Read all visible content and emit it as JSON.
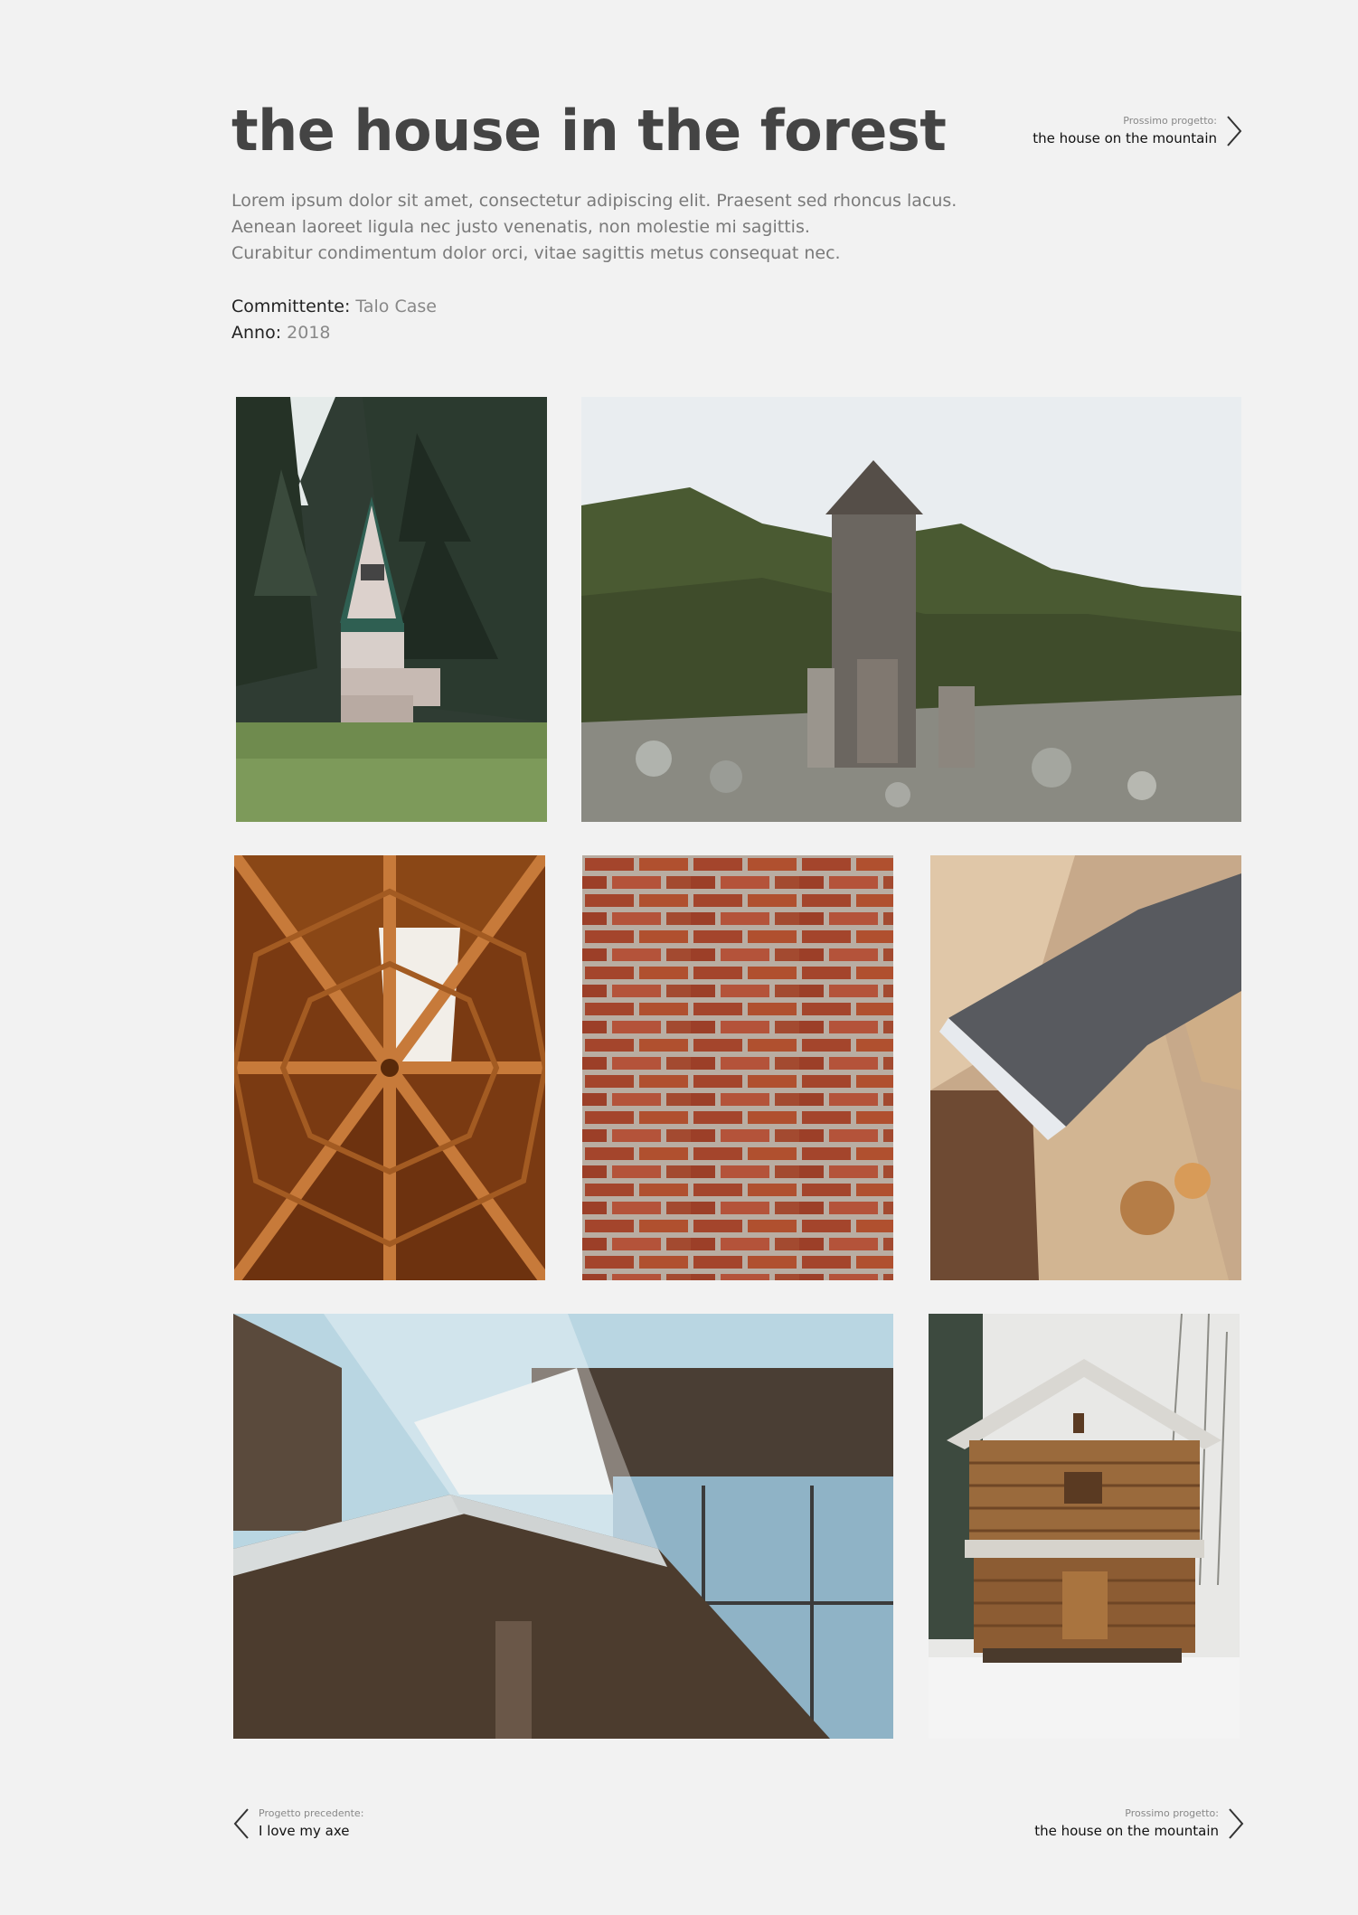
{
  "project": {
    "title": "the house in the forest",
    "description": [
      "Lorem ipsum dolor sit amet, consectetur adipiscing elit. Praesent sed rhoncus lacus.",
      "Aenean laoreet ligula nec justo venenatis, non molestie mi sagittis.",
      "Curabitur condimentum dolor orci, vitae sagittis metus consequat nec."
    ],
    "client_label": "Committente:",
    "client_value": "Talo Case",
    "year_label": "Anno:",
    "year_value": "2018"
  },
  "nav_top": {
    "caption": "Prossimo progetto:",
    "project": "the house on the mountain"
  },
  "nav_bottom": {
    "prev_caption": "Progetto precedente:",
    "prev_project": "I love my axe",
    "next_caption": "Prossimo progetto:",
    "next_project": "the house on the mountain"
  },
  "gallery": [
    {
      "subject": "a-frame cabin in pine forest"
    },
    {
      "subject": "wooden hut on rocky hillside"
    },
    {
      "subject": "wooden roof beams from below"
    },
    {
      "subject": "red brick wall"
    },
    {
      "subject": "axe in chopped wood"
    },
    {
      "subject": "modern wooden house with glass balcony"
    },
    {
      "subject": "log cabin in snow"
    }
  ]
}
